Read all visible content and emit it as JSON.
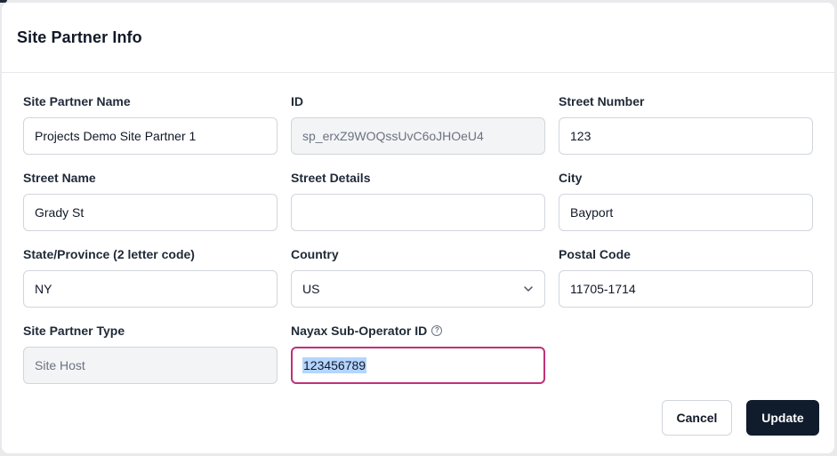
{
  "modal": {
    "title": "Site Partner Info"
  },
  "fields": {
    "site_partner_name": {
      "label": "Site Partner Name",
      "value": "Projects Demo Site Partner 1"
    },
    "id": {
      "label": "ID",
      "value": "sp_erxZ9WOQssUvC6oJHOeU4"
    },
    "street_number": {
      "label": "Street Number",
      "value": "123"
    },
    "street_name": {
      "label": "Street Name",
      "value": "Grady St"
    },
    "street_details": {
      "label": "Street Details",
      "value": ""
    },
    "city": {
      "label": "City",
      "value": "Bayport"
    },
    "state": {
      "label": "State/Province (2 letter code)",
      "value": "NY"
    },
    "country": {
      "label": "Country",
      "value": "US"
    },
    "postal_code": {
      "label": "Postal Code",
      "value": "11705-1714"
    },
    "site_partner_type": {
      "label": "Site Partner Type",
      "value": "Site Host"
    },
    "nayax_sub_operator_id": {
      "label": "Nayax Sub-Operator ID",
      "help_icon": "?",
      "value": "123456789"
    }
  },
  "buttons": {
    "cancel": "Cancel",
    "update": "Update"
  },
  "colors": {
    "focus_border": "#c0307a",
    "primary_button": "#101c2c",
    "text_selection": "#b4d5fe"
  }
}
